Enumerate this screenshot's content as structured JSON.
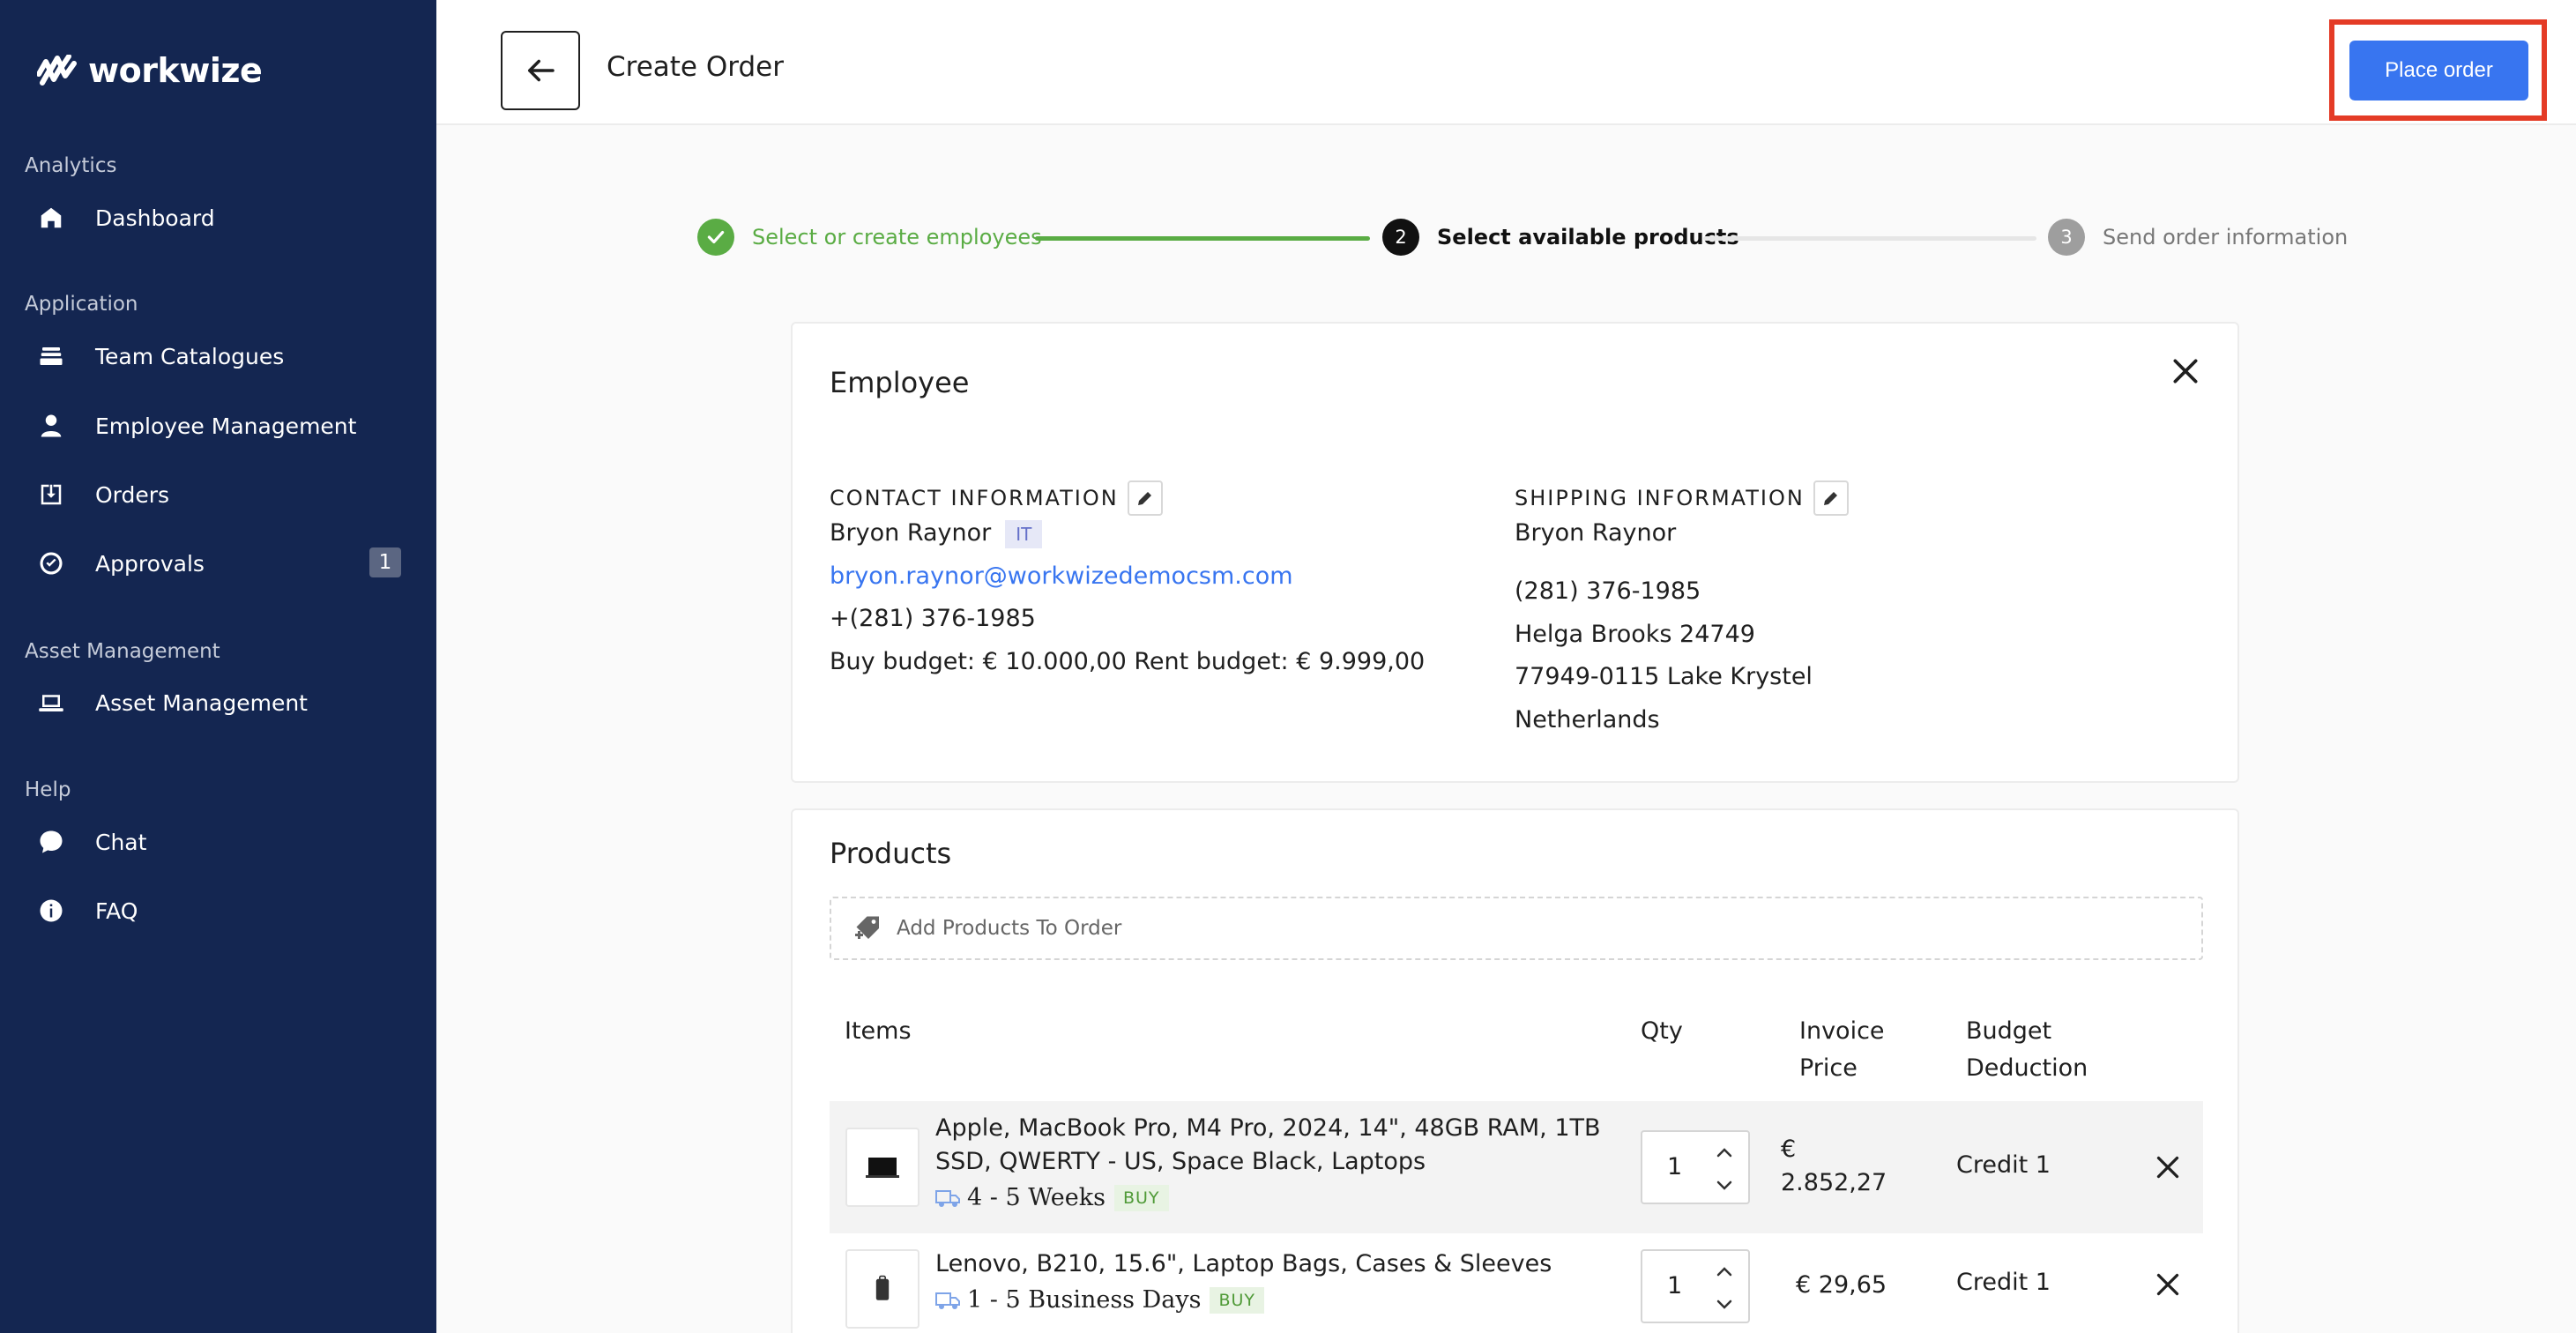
{
  "brand": {
    "name": "workwize"
  },
  "sidebar": {
    "sections": [
      {
        "title": "Analytics"
      },
      {
        "title": "Application"
      },
      {
        "title": "Asset Management"
      },
      {
        "title": "Help"
      }
    ],
    "items": [
      {
        "label": "Dashboard",
        "icon": "home-icon"
      },
      {
        "label": "Team Catalogues",
        "icon": "layers-icon"
      },
      {
        "label": "Employee Management",
        "icon": "person-icon"
      },
      {
        "label": "Orders",
        "icon": "download-box-icon"
      },
      {
        "label": "Approvals",
        "icon": "check-circle-icon",
        "badge": "1"
      },
      {
        "label": "Asset Management",
        "icon": "laptop-icon"
      },
      {
        "label": "Chat",
        "icon": "chat-bubble-icon"
      },
      {
        "label": "FAQ",
        "icon": "info-icon"
      }
    ]
  },
  "header": {
    "title": "Create Order",
    "place_order_label": "Place order"
  },
  "stepper": {
    "steps": [
      {
        "label": "Select or create employees",
        "state": "done"
      },
      {
        "number": "2",
        "label": "Select available products",
        "state": "active"
      },
      {
        "number": "3",
        "label": "Send order information",
        "state": "pending"
      }
    ],
    "colors": {
      "done": "#5aac44",
      "active": "#111111",
      "pending": "#9e9e9e"
    }
  },
  "employee": {
    "title": "Employee",
    "contact": {
      "label": "CONTACT INFORMATION",
      "name": "Bryon Raynor",
      "department": "IT",
      "email": "bryon.raynor@workwizedemocsm.com",
      "phone": "+(281) 376-1985",
      "budget": "Buy budget: € 10.000,00 Rent budget: € 9.999,00"
    },
    "shipping": {
      "label": "SHIPPING INFORMATION",
      "name": "Bryon Raynor",
      "phone": "(281) 376-1985",
      "street": "Helga Brooks 24749",
      "city": "77949-0115 Lake Krystel",
      "country": "Netherlands"
    }
  },
  "products": {
    "title": "Products",
    "add_placeholder": "Add Products To Order",
    "columns": {
      "items": "Items",
      "qty": "Qty",
      "invoice_price_1": "Invoice",
      "invoice_price_2": "Price",
      "budget_1": "Budget",
      "budget_2": "Deduction"
    },
    "rows": [
      {
        "name": "Apple, MacBook Pro, M4 Pro, 2024, 14\", 48GB RAM, 1TB SSD, QWERTY - US, Space Black, Laptops",
        "delivery": "4 - 5 Weeks",
        "tag": "BUY",
        "qty": "1",
        "price_1": "€",
        "price_2": "2.852,27",
        "budget": "Credit 1"
      },
      {
        "name": "Lenovo, B210, 15.6\", Laptop Bags, Cases & Sleeves",
        "delivery": "1 - 5 Business Days",
        "tag": "BUY",
        "qty": "1",
        "price": "€ 29,65",
        "budget": "Credit 1"
      }
    ]
  },
  "colors": {
    "sidebar_bg": "#142651",
    "primary": "#3875f0",
    "highlight": "#e43b26",
    "success": "#5aac44"
  }
}
